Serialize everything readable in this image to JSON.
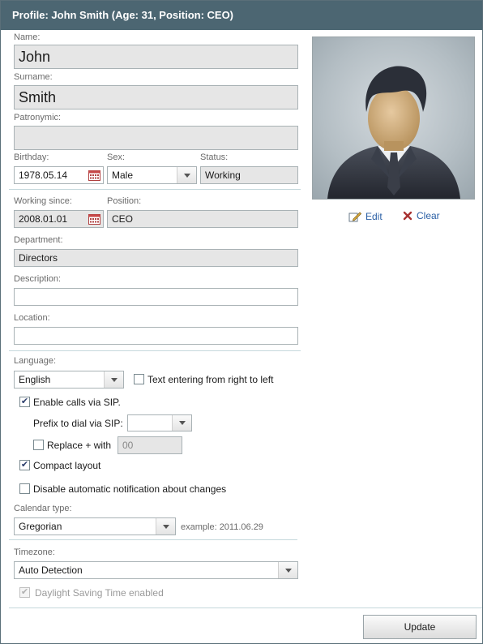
{
  "title": "Profile: John Smith (Age: 31, Position: CEO)",
  "fields": {
    "name": {
      "label": "Name:",
      "value": "John"
    },
    "surname": {
      "label": "Surname:",
      "value": "Smith"
    },
    "patronymic": {
      "label": "Patronymic:",
      "value": ""
    },
    "birthday": {
      "label": "Birthday:",
      "value": "1978.05.14"
    },
    "sex": {
      "label": "Sex:",
      "value": "Male"
    },
    "status": {
      "label": "Status:",
      "value": "Working"
    },
    "working_since": {
      "label": "Working since:",
      "value": "2008.01.01"
    },
    "position": {
      "label": "Position:",
      "value": "CEO"
    },
    "department": {
      "label": "Department:",
      "value": "Directors"
    },
    "description": {
      "label": "Description:",
      "value": ""
    },
    "location": {
      "label": "Location:",
      "value": ""
    }
  },
  "photo_actions": {
    "edit": "Edit",
    "clear": "Clear"
  },
  "language": {
    "label": "Language:",
    "value": "English"
  },
  "rtl": {
    "label": "Text entering from right to left",
    "checked": false
  },
  "sip": {
    "label": "Enable calls via SIP.",
    "checked": true
  },
  "prefix": {
    "label": "Prefix to dial via SIP:",
    "value": ""
  },
  "replace_plus": {
    "label": "Replace + with",
    "checked": false,
    "value": "00"
  },
  "compact": {
    "label": "Compact layout",
    "checked": true
  },
  "disable_notify": {
    "label": "Disable automatic notification about changes",
    "checked": false
  },
  "calendar": {
    "label": "Calendar type:",
    "value": "Gregorian",
    "example": "example: 2011.06.29"
  },
  "timezone": {
    "label": "Timezone:",
    "value": "Auto Detection"
  },
  "dst": {
    "label": "Daylight Saving Time enabled",
    "checked": true,
    "disabled": true
  },
  "update_button": "Update",
  "colors": {
    "titlebar": "#4c6672",
    "link": "#2a5fa5",
    "clear_icon": "#a83232"
  }
}
